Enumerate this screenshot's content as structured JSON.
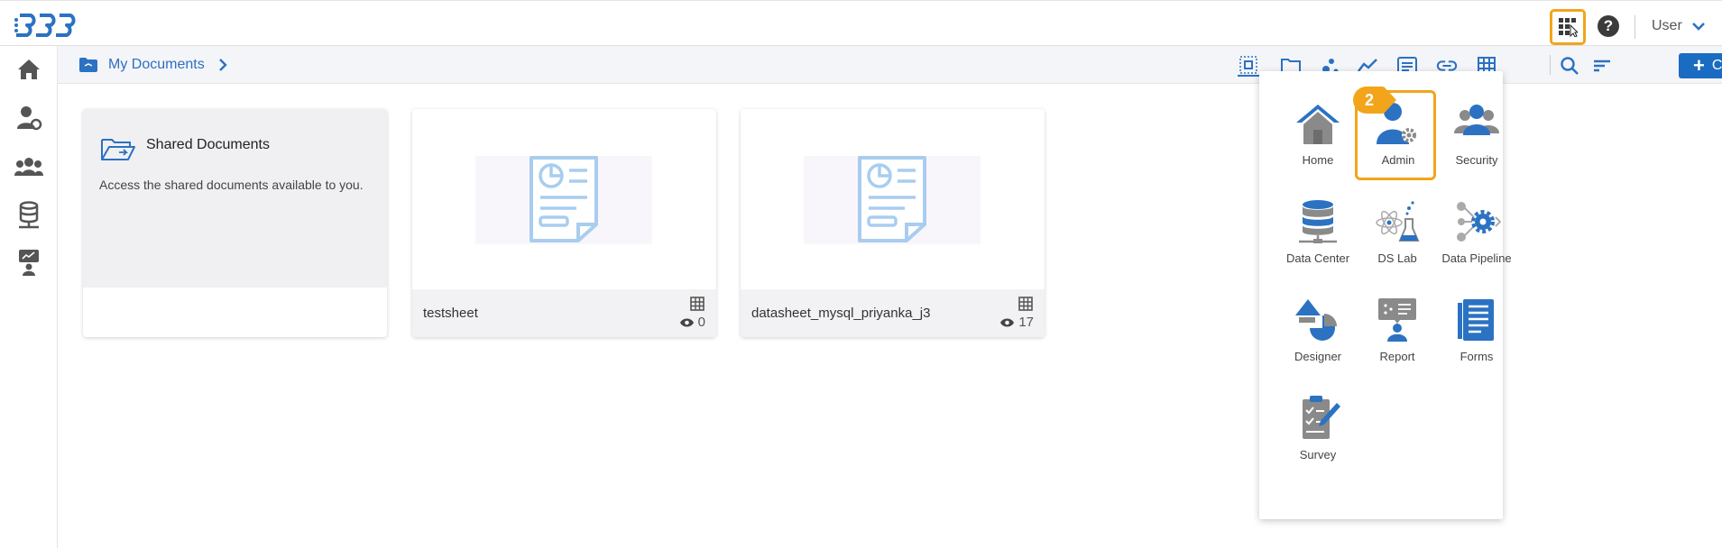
{
  "topbar": {
    "help_glyph": "?",
    "user_label": "User",
    "icons": [
      "bdb-logo",
      "apps-grid-icon",
      "help-icon",
      "chevron-down-icon"
    ]
  },
  "sidebar": {
    "items": [
      {
        "name": "home",
        "icon": "home-icon"
      },
      {
        "name": "admin",
        "icon": "admin-user-icon"
      },
      {
        "name": "security",
        "icon": "users-group-icon"
      },
      {
        "name": "data-center",
        "icon": "database-icon"
      },
      {
        "name": "report",
        "icon": "report-icon"
      }
    ]
  },
  "breadcrumb": {
    "label": "My Documents"
  },
  "toolbar": {
    "create_label": "Create",
    "create_plus": "+",
    "tools": [
      "all-icon",
      "folder-icon",
      "scatter-icon",
      "line-chart-icon",
      "list-icon",
      "link-icon",
      "table-icon",
      "search-icon",
      "sort-icon"
    ]
  },
  "cards": {
    "shared": {
      "title": "Shared Documents",
      "description": "Access the shared documents available to you."
    },
    "docs": [
      {
        "name": "testsheet",
        "views": "0"
      },
      {
        "name": "datasheet_mysql_priyanka_j3",
        "views": "17"
      }
    ]
  },
  "apps_menu": {
    "badge": "2",
    "items": [
      {
        "label": "Home",
        "icon": "home-icon"
      },
      {
        "label": "Admin",
        "icon": "admin-user-icon"
      },
      {
        "label": "Security",
        "icon": "users-group-icon"
      },
      {
        "label": "Data Center",
        "icon": "database-icon"
      },
      {
        "label": "DS Lab",
        "icon": "atom-flask-icon"
      },
      {
        "label": "Data Pipeline",
        "icon": "pipeline-icon"
      },
      {
        "label": "Designer",
        "icon": "designer-icon"
      },
      {
        "label": "Report",
        "icon": "report-icon"
      },
      {
        "label": "Forms",
        "icon": "forms-icon"
      },
      {
        "label": "Survey",
        "icon": "survey-icon"
      }
    ]
  },
  "colors": {
    "accent": "#1a6cc2",
    "highlight": "#f2a51a",
    "icon_gray": "#8a8a8a",
    "icon_blue": "#2b72c2"
  }
}
